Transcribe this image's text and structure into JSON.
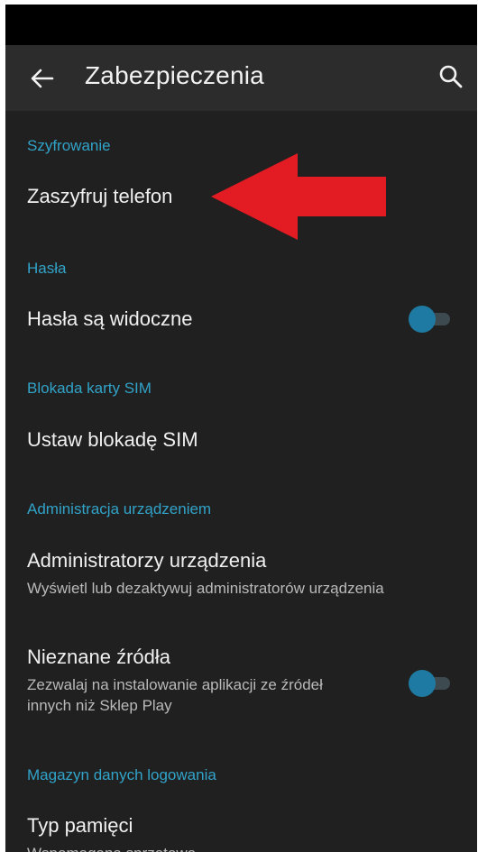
{
  "app_bar": {
    "title": "Zabezpieczenia",
    "back_icon": "arrow-left-icon",
    "search_icon": "search-icon"
  },
  "colors": {
    "background": "#202020",
    "app_bar": "#2c2c2c",
    "section_header": "#31a3c9",
    "toggle_thumb": "#1e7aa2",
    "arrow": "#e31b23"
  },
  "sections": [
    {
      "header": "Szyfrowanie",
      "items": [
        {
          "title": "Zaszyfruj telefon"
        }
      ]
    },
    {
      "header": "Hasła",
      "items": [
        {
          "title": "Hasła są widoczne",
          "toggle": "off"
        }
      ]
    },
    {
      "header": "Blokada karty SIM",
      "items": [
        {
          "title": "Ustaw blokadę SIM"
        }
      ]
    },
    {
      "header": "Administracja urządzeniem",
      "items": [
        {
          "title": "Administratorzy urządzenia",
          "summary": "Wyświetl lub dezaktywuj administratorów urządzenia"
        },
        {
          "title": "Nieznane źródła",
          "summary_line1": "Zezwalaj na instalowanie aplikacji ze źródeł",
          "summary_line2": "innych niż Sklep Play",
          "toggle": "off"
        }
      ]
    },
    {
      "header": "Magazyn danych logowania",
      "items": [
        {
          "title": "Typ pamięci",
          "summary": "Wspomagana sprzętowo"
        }
      ]
    }
  ],
  "annotation": "red-arrow-pointing-left"
}
